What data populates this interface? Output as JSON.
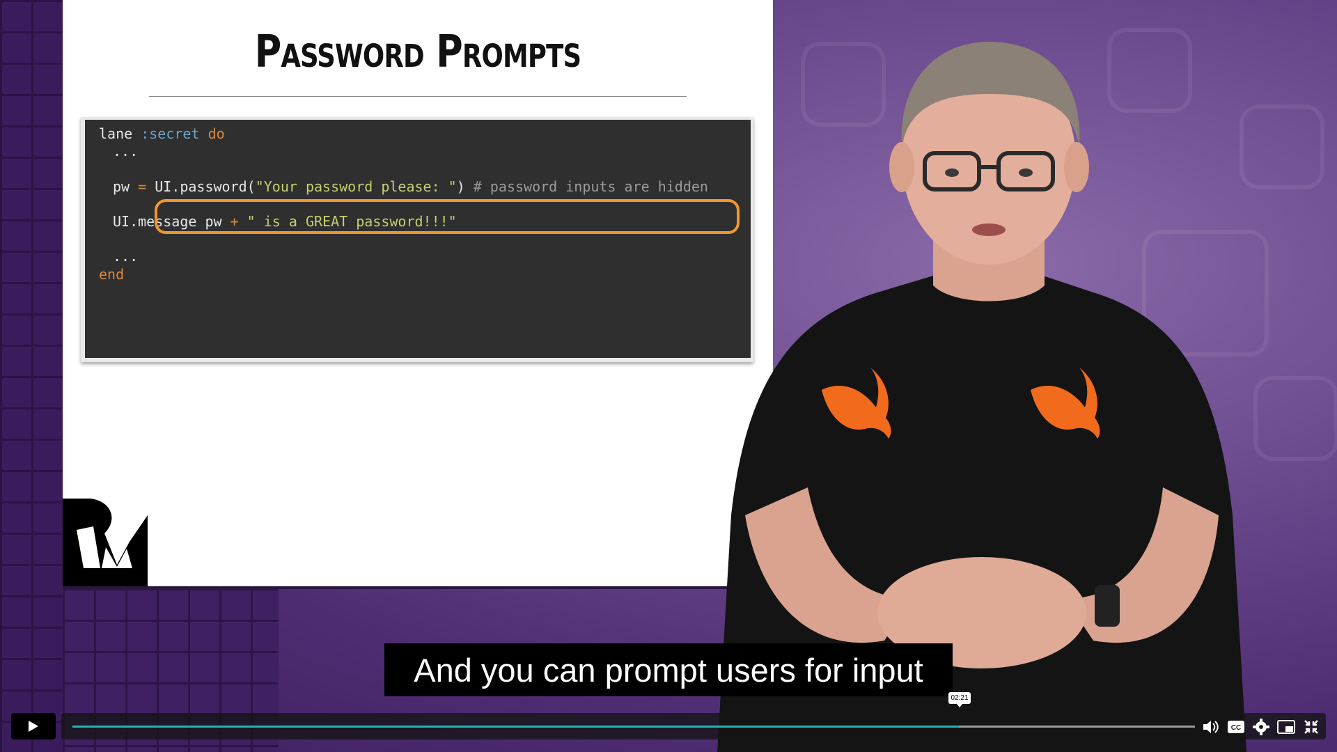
{
  "slide": {
    "title": "Password Prompts",
    "code_lines": [
      {
        "indent": "",
        "parts": [
          [
            "plain",
            "lane "
          ],
          [
            "sym",
            ":secret"
          ],
          [
            "plain",
            " "
          ],
          [
            "kw",
            "do"
          ]
        ]
      },
      {
        "indent": "  ",
        "parts": [
          [
            "plain",
            "..."
          ]
        ]
      },
      {
        "indent": "",
        "parts": []
      },
      {
        "indent": "  ",
        "parts": [
          [
            "plain",
            "pw "
          ],
          [
            "op",
            "="
          ],
          [
            "plain",
            " UI.password("
          ],
          [
            "str",
            "\"Your password please: \""
          ],
          [
            "plain",
            ") "
          ],
          [
            "cm",
            "# password inputs are hidden"
          ]
        ]
      },
      {
        "indent": "",
        "parts": []
      },
      {
        "indent": "  ",
        "parts": [
          [
            "plain",
            "UI.message pw "
          ],
          [
            "op",
            "+"
          ],
          [
            "plain",
            " "
          ],
          [
            "str",
            "\" is a GREAT password!!!\""
          ]
        ]
      },
      {
        "indent": "",
        "parts": []
      },
      {
        "indent": "  ",
        "parts": [
          [
            "plain",
            "..."
          ]
        ]
      },
      {
        "indent": "",
        "parts": [
          [
            "kw",
            "end"
          ]
        ]
      }
    ]
  },
  "subtitle": "And you can prompt users for input",
  "player": {
    "time_tooltip": "02:21",
    "progress_fraction": 0.79,
    "controls": [
      "play-icon",
      "volume-icon",
      "captions-icon",
      "settings-icon",
      "pip-icon",
      "exit-fullscreen-icon"
    ],
    "accent_color": "#23b3b3"
  },
  "colors": {
    "highlight": "#f0982e",
    "code_bg": "#2f2f2f",
    "swift_logo": "#f26b1d"
  }
}
